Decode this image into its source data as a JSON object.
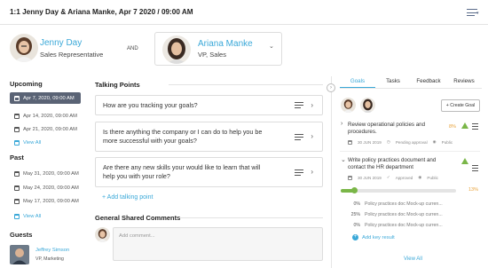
{
  "header": {
    "title": "1:1 Jenny Day & Ariana Manke, Apr 7 2020 / 09:00 AM"
  },
  "participants": {
    "a": {
      "name": "Jenny Day",
      "role": "Sales Representative"
    },
    "and_label": "AND",
    "b": {
      "name": "Ariana Manke",
      "role": "VP, Sales"
    }
  },
  "upcoming": {
    "heading": "Upcoming",
    "items": [
      "Apr 7, 2020, 09:00 AM",
      "Apr 14, 2020, 09:00 AM",
      "Apr 21, 2020, 09:00 AM"
    ],
    "view_all": "View All"
  },
  "past": {
    "heading": "Past",
    "items": [
      "May 31, 2020, 09:00 AM",
      "May 24, 2020, 09:00 AM",
      "May 17, 2020, 09:00 AM"
    ],
    "view_all": "View All"
  },
  "guests": {
    "heading": "Guests",
    "items": [
      {
        "name": "Jeffrey Simson",
        "role": "VP, Marketing"
      }
    ]
  },
  "talking_points": {
    "heading": "Talking Points",
    "items": [
      "How are you tracking your goals?",
      "Is there anything the company or I can do to help you be more successful with your goals?",
      "Are there any new skills your would like to learn that will help you with your role?"
    ],
    "add_label": "+ Add talking point"
  },
  "comments": {
    "heading": "General Shared Comments",
    "placeholder": "Add comment..."
  },
  "right_panel": {
    "tabs": [
      "Goals",
      "Tasks",
      "Feedback",
      "Reviews"
    ],
    "create_goal": "+ Create Goal",
    "goals": [
      {
        "title": "Review operational policies and procedures.",
        "date": "30 JUN 2019",
        "status": "Pending approval",
        "visibility": "Public",
        "percent": "8%"
      },
      {
        "title": "Write policy practices document and contact the HR department",
        "date": "30 JUN 2019",
        "status": "Approved",
        "visibility": "Public",
        "percent": "13%",
        "progress": 0.13,
        "key_results": [
          {
            "value": "0%",
            "text": "Policy practices doc Mock-up curren..."
          },
          {
            "value": "25%",
            "text": "Policy practices doc Mock-up curren..."
          },
          {
            "value": "0%",
            "text": "Policy practices doc Mock-up curren..."
          }
        ],
        "add_kr": "Add key result"
      }
    ],
    "view_all": "View All"
  },
  "colors": {
    "accent": "#3aa8d8",
    "warning": "#7ab648",
    "orange": "#e8a23a",
    "active_item_bg": "#5a6375"
  }
}
